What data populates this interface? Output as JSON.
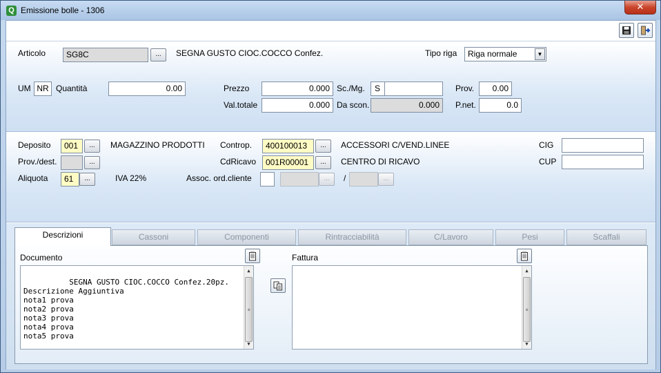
{
  "window": {
    "title": "Emissione bolle - 1306",
    "close": "✕"
  },
  "articolo": {
    "label": "Articolo",
    "code": "SG8C",
    "description": "SEGNA GUSTO CIOC.COCCO Confez.",
    "tipo_riga_label": "Tipo riga",
    "tipo_riga_value": "Riga normale"
  },
  "qty": {
    "um_label": "UM",
    "um_value": "NR",
    "quantita_label": "Quantità",
    "quantita_value": "0.00",
    "prezzo_label": "Prezzo",
    "prezzo_value": "0.000",
    "valtotale_label": "Val.totale",
    "valtotale_value": "0.000",
    "scmg_label": "Sc./Mg.",
    "scmg_value": "S",
    "scmg_extra": "",
    "dascon_label": "Da scon.",
    "dascon_value": "0.000",
    "prov_label": "Prov.",
    "prov_value": "0.00",
    "pnet_label": "P.net.",
    "pnet_value": "0.0"
  },
  "deposito": {
    "label": "Deposito",
    "code": "001",
    "description": "MAGAZZINO PRODOTTI",
    "provdest_label": "Prov./dest.",
    "provdest_value": "",
    "aliquota_label": "Aliquota",
    "aliquota_code": "61",
    "aliquota_desc": "IVA 22%",
    "controp_label": "Controp.",
    "controp_code": "400100013",
    "controp_desc": "ACCESSORI C/VEND.LINEE",
    "cdricavo_label": "CdRicavo",
    "cdricavo_code": "001R00001",
    "cdricavo_desc": "CENTRO DI RICAVO",
    "assoc_label": "Assoc. ord.cliente",
    "assoc_sep": "/",
    "cig_label": "CIG",
    "cig_value": "",
    "cup_label": "CUP",
    "cup_value": ""
  },
  "tabs": [
    "Descrizioni",
    "Cassoni",
    "Componenti",
    "Rintracciabilità",
    "C/Lavoro",
    "Pesi",
    "Scaffali"
  ],
  "descrizioni": {
    "documento_label": "Documento",
    "documento_text": "SEGNA GUSTO CIOC.COCCO Confez.20pz.\nDescrizione Aggiuntiva\nnota1 prova\nnota2 prova\nnota3 prova\nnota4 prova\nnota5 prova",
    "fattura_label": "Fattura",
    "fattura_text": ""
  },
  "common": {
    "dots": "...",
    "arrow_down": "▼",
    "arrow_up": "▲",
    "grip": "≡"
  }
}
